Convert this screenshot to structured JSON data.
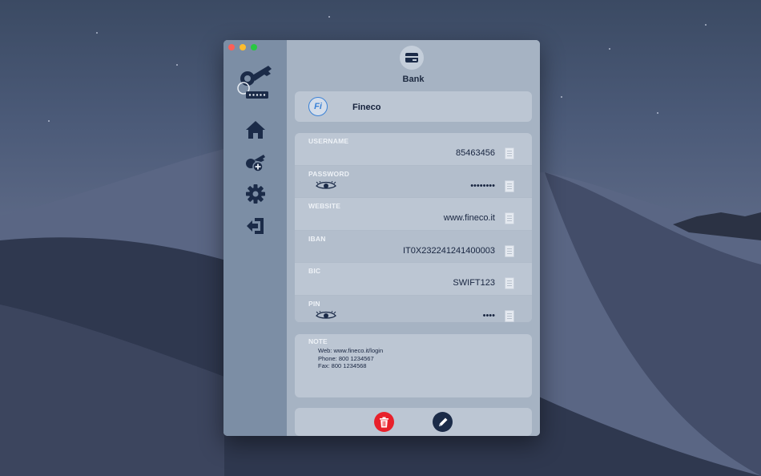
{
  "window": {
    "category": {
      "label": "Bank",
      "icon": "credit-card-icon"
    },
    "entry": {
      "name": "Fineco",
      "logo_text": "Fi"
    },
    "fields": [
      {
        "label": "USERNAME",
        "value": "85463456",
        "hidden": false
      },
      {
        "label": "PASSWORD",
        "value": "••••••••",
        "hidden": true
      },
      {
        "label": "WEBSITE",
        "value": "www.fineco.it",
        "hidden": false
      },
      {
        "label": "IBAN",
        "value": "IT0X232241241400003",
        "hidden": false
      },
      {
        "label": "BIC",
        "value": "SWIFT123",
        "hidden": false
      },
      {
        "label": "PIN",
        "value": "••••",
        "hidden": true
      }
    ],
    "note": {
      "label": "NOTE",
      "lines": [
        "Web: www.fineco.it/login",
        "Phone: 800 1234567",
        "Fax: 800 1234568"
      ]
    },
    "sidebar": {
      "items": [
        "home-icon",
        "add-key-icon",
        "gear-icon",
        "logout-icon"
      ]
    },
    "actions": {
      "delete": "trash-icon",
      "edit": "pencil-icon"
    },
    "colors": {
      "sidebar": "#7c8ea5",
      "main": "#a6b3c3",
      "card": "#bcc6d3",
      "icon_dark": "#1b2b48",
      "delete_red": "#e8202a",
      "accent_blue": "#3b82d6"
    }
  }
}
